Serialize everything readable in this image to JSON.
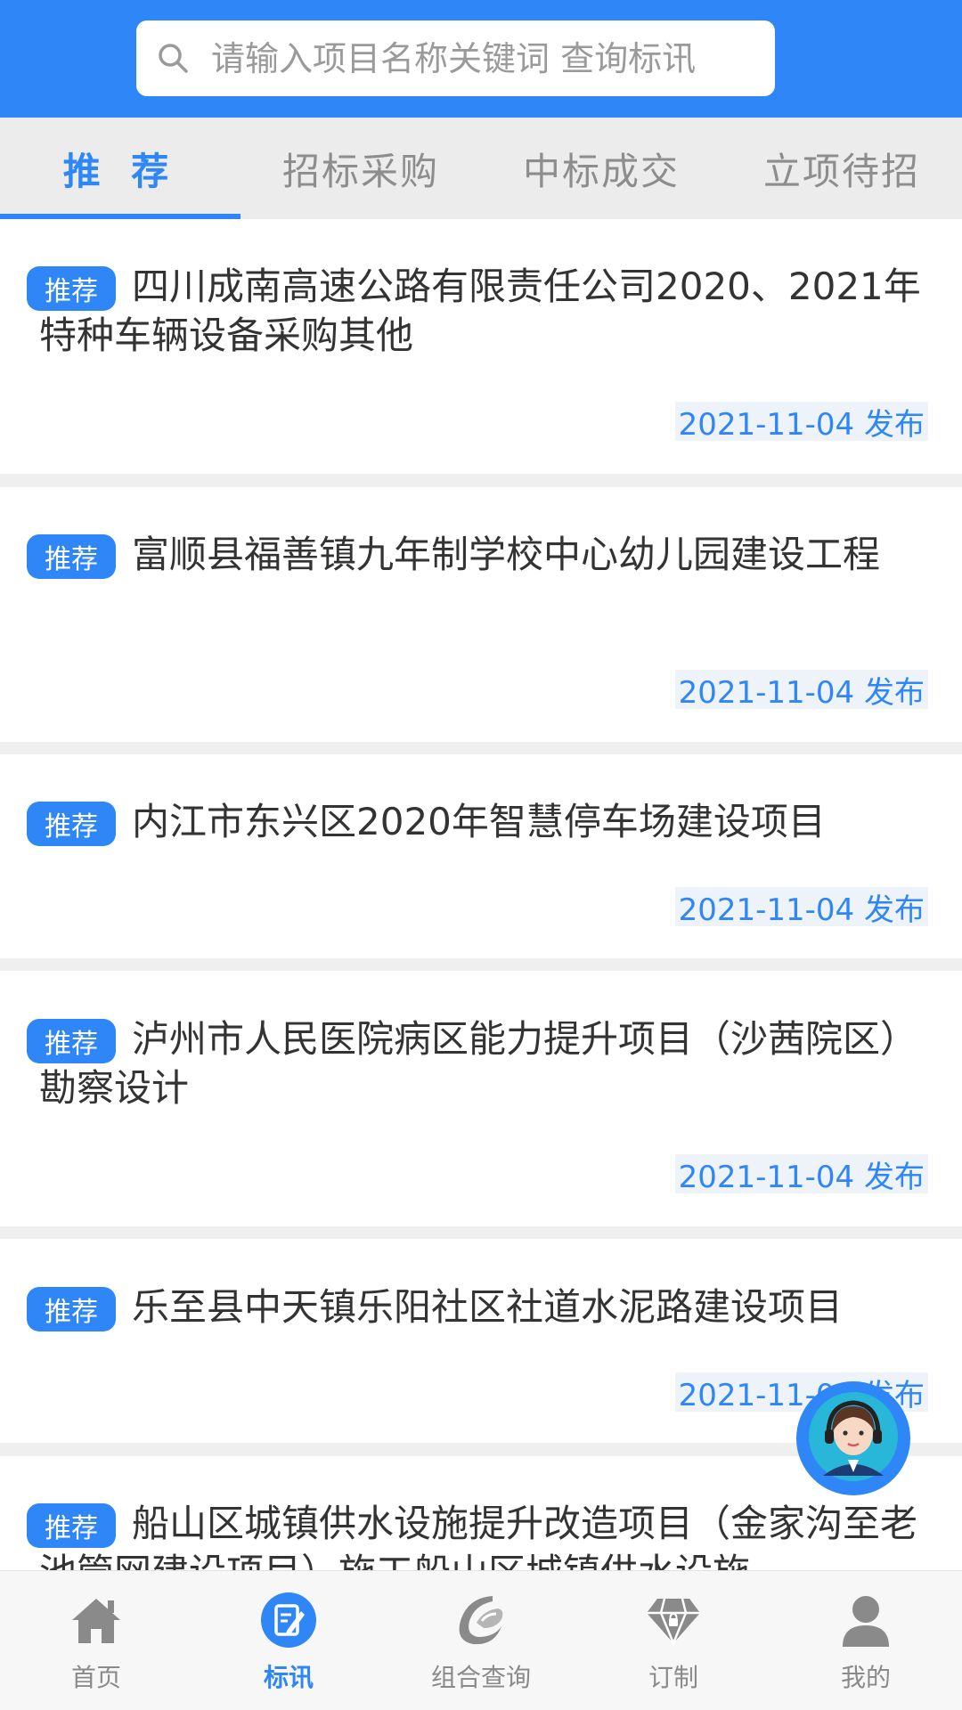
{
  "search": {
    "placeholder": "请输入项目名称关键词 查询标讯"
  },
  "tabs": [
    {
      "label": "推 荐"
    },
    {
      "label": "招标采购"
    },
    {
      "label": "中标成交"
    },
    {
      "label": "立项待招"
    }
  ],
  "items": [
    {
      "badge": "推荐",
      "title": "四川成南高速公路有限责任公司2020、2021年特种车辆设备采购其他",
      "date": "2021-11-04 发布"
    },
    {
      "badge": "推荐",
      "title": "富顺县福善镇九年制学校中心幼儿园建设工程",
      "date": "2021-11-04 发布"
    },
    {
      "badge": "推荐",
      "title": "内江市东兴区2020年智慧停车场建设项目",
      "date": "2021-11-04 发布"
    },
    {
      "badge": "推荐",
      "title": "泸州市人民医院病区能力提升项目（沙茜院区）勘察设计",
      "date": "2021-11-04 发布"
    },
    {
      "badge": "推荐",
      "title": "乐至县中天镇乐阳社区社道水泥路建设项目",
      "date": "2021-11-04 发布"
    },
    {
      "badge": "推荐",
      "title": "船山区城镇供水设施提升改造项目（金家沟至老池管网建设项目）施工船山区城镇供水设施",
      "date": ""
    }
  ],
  "service": {
    "icon": "customer-service-icon"
  },
  "nav": [
    {
      "label": "首页",
      "icon": "home-icon"
    },
    {
      "label": "标讯",
      "icon": "bid-info-icon"
    },
    {
      "label": "组合查询",
      "icon": "combo-search-icon"
    },
    {
      "label": "订制",
      "icon": "diamond-icon"
    },
    {
      "label": "我的",
      "icon": "user-icon"
    }
  ],
  "colors": {
    "primary": "#2f86f6",
    "tab_bg": "#ececec",
    "date_bg": "#eef3fa"
  }
}
